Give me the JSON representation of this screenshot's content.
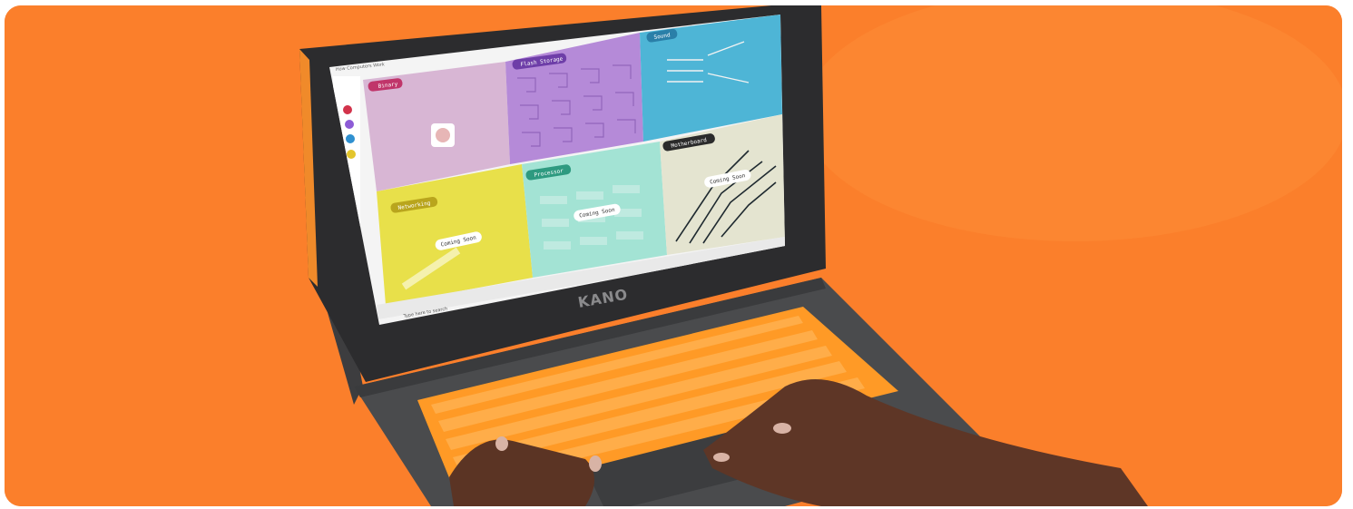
{
  "scene": {
    "background_color": "#fb7f2b",
    "device_brand": "KANO",
    "keyboard_color": "#ff9a26"
  },
  "screen": {
    "window_title": "How Computers Work",
    "tiles": {
      "binary": {
        "label": "Binary",
        "color": "#d8b6d4"
      },
      "flash_storage": {
        "label": "Flash Storage",
        "color": "#b58ad8"
      },
      "sound": {
        "label": "Sound",
        "color": "#4eb5d6"
      },
      "motherboard": {
        "label": "Motherboard",
        "status": "Coming Soon",
        "color": "#e4e4d0"
      },
      "processor": {
        "label": "Processor",
        "status": "Coming Soon",
        "color": "#a3e3d4"
      },
      "networking": {
        "label": "Networking",
        "status": "Coming Soon",
        "color": "#e8e04a"
      }
    },
    "taskbar": {
      "search_placeholder": "Type here to search"
    }
  }
}
